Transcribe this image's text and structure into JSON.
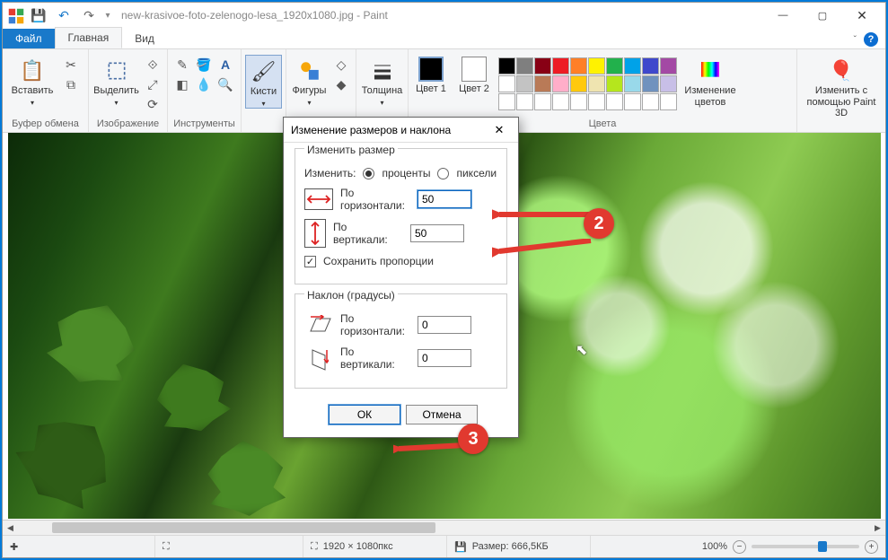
{
  "title": "new-krasivoe-foto-zelenogo-lesa_1920x1080.jpg - Paint",
  "tabs": {
    "file": "Файл",
    "home": "Главная",
    "view": "Вид"
  },
  "ribbon": {
    "clipboard": {
      "paste": "Вставить",
      "label": "Буфер обмена"
    },
    "image": {
      "select": "Выделить",
      "label": "Изображение"
    },
    "tools": {
      "label": "Инструменты"
    },
    "brushes": {
      "label": "Кисти"
    },
    "shapes": {
      "label": "Фигуры"
    },
    "size": {
      "label": "Толщина"
    },
    "colors": {
      "c1": "Цвет 1",
      "c2": "Цвет 2",
      "edit": "Изменение цветов",
      "label": "Цвета"
    },
    "paint3d": {
      "label": "Изменить с помощью Paint 3D"
    }
  },
  "palette": {
    "c1_color": "#000000",
    "c2_color": "#ffffff",
    "row1": [
      "#000000",
      "#7f7f7f",
      "#880015",
      "#ed1c24",
      "#ff7f27",
      "#fff200",
      "#22b14c",
      "#00a2e8",
      "#3f48cc",
      "#a349a4"
    ],
    "row2": [
      "#ffffff",
      "#c3c3c3",
      "#b97a57",
      "#ffaec9",
      "#ffc90e",
      "#efe4b0",
      "#b5e61d",
      "#99d9ea",
      "#7092be",
      "#c8bfe7"
    ]
  },
  "dialog": {
    "title": "Изменение размеров и наклона",
    "resize_legend": "Изменить размер",
    "by_label": "Изменить:",
    "percent": "проценты",
    "pixels": "пиксели",
    "horiz": "По горизонтали:",
    "vert": "По вертикали:",
    "h_val": "50",
    "v_val": "50",
    "keep_aspect": "Сохранить пропорции",
    "skew_legend": "Наклон (градусы)",
    "skew_h": "0",
    "skew_v": "0",
    "ok": "ОК",
    "cancel": "Отмена"
  },
  "status": {
    "dims": "1920 × 1080пкс",
    "size_label": "Размер: 666,5КБ",
    "zoom": "100%"
  },
  "anno": {
    "a2": "2",
    "a3": "3"
  }
}
